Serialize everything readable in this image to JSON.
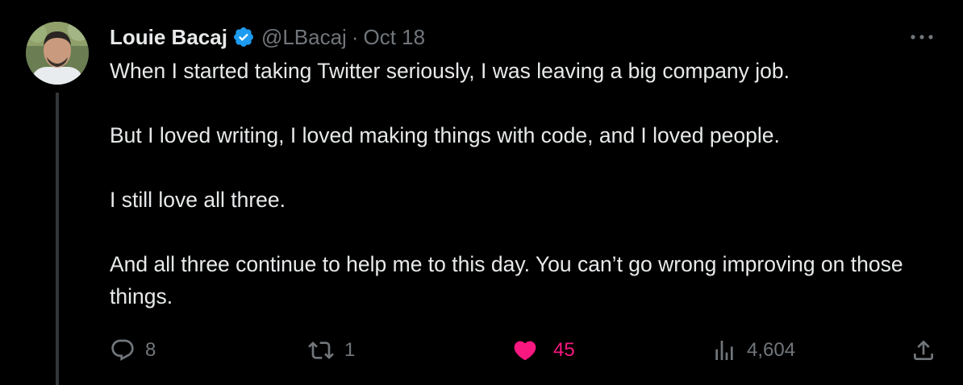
{
  "tweet": {
    "author": {
      "display_name": "Louie Bacaj",
      "handle": "@LBacaj",
      "verified": true
    },
    "separator": "·",
    "date": "Oct 18",
    "paragraphs": [
      "When I started taking Twitter seriously, I was leaving a big company job.",
      "But I loved writing, I loved making things with code, and I loved people.",
      "I still love all three.",
      "And all three continue to help me to this day. You can’t go wrong improving on those things."
    ],
    "actions": {
      "replies": "8",
      "retweets": "1",
      "likes": "45",
      "views": "4,604"
    }
  },
  "colors": {
    "background": "#000000",
    "text_primary": "#e7e9ea",
    "text_secondary": "#71767b",
    "verified_blue": "#1d9bf0",
    "like_pink": "#f91880",
    "thread_line": "#333639"
  },
  "icons": {
    "more": "more-horizontal-icon",
    "verified": "verified-badge-icon",
    "reply": "reply-icon",
    "retweet": "retweet-icon",
    "like": "heart-filled-icon",
    "views": "views-bar-chart-icon",
    "share": "share-icon"
  }
}
